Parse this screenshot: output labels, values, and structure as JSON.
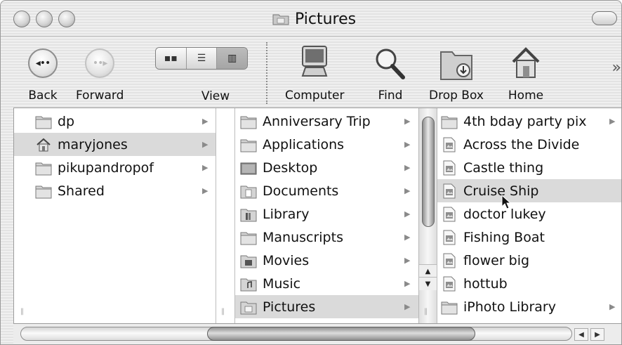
{
  "window": {
    "title": "Pictures"
  },
  "toolbar": {
    "back_label": "Back",
    "forward_label": "Forward",
    "view_label": "View",
    "computer_label": "Computer",
    "find_label": "Find",
    "dropbox_label": "Drop Box",
    "home_label": "Home"
  },
  "columns": [
    {
      "items": [
        {
          "label": "dp",
          "icon": "folder-icon",
          "selected": false,
          "has_children": true
        },
        {
          "label": "maryjones",
          "icon": "home-icon",
          "selected": true,
          "has_children": true
        },
        {
          "label": "pikupandropof",
          "icon": "folder-icon",
          "selected": false,
          "has_children": true
        },
        {
          "label": "Shared",
          "icon": "folder-icon",
          "selected": false,
          "has_children": true
        }
      ]
    },
    {
      "items": [
        {
          "label": "Anniversary Trip",
          "icon": "folder-icon",
          "selected": false,
          "has_children": true
        },
        {
          "label": "Applications",
          "icon": "folder-icon",
          "selected": false,
          "has_children": true
        },
        {
          "label": "Desktop",
          "icon": "desktop-folder-icon",
          "selected": false,
          "has_children": true
        },
        {
          "label": "Documents",
          "icon": "documents-folder-icon",
          "selected": false,
          "has_children": true
        },
        {
          "label": "Library",
          "icon": "library-folder-icon",
          "selected": false,
          "has_children": true
        },
        {
          "label": "Manuscripts",
          "icon": "folder-icon",
          "selected": false,
          "has_children": true
        },
        {
          "label": "Movies",
          "icon": "movies-folder-icon",
          "selected": false,
          "has_children": true
        },
        {
          "label": "Music",
          "icon": "music-folder-icon",
          "selected": false,
          "has_children": true
        },
        {
          "label": "Pictures",
          "icon": "pictures-folder-icon",
          "selected": true,
          "has_children": true
        }
      ]
    },
    {
      "items": [
        {
          "label": "4th bday party pix",
          "icon": "folder-icon",
          "selected": false,
          "has_children": true
        },
        {
          "label": "Across the Divide",
          "icon": "image-file-icon",
          "selected": false,
          "has_children": false
        },
        {
          "label": "Castle thing",
          "icon": "image-file-icon",
          "selected": false,
          "has_children": false
        },
        {
          "label": "Cruise Ship",
          "icon": "image-file-icon",
          "selected": true,
          "has_children": false
        },
        {
          "label": "doctor lukey",
          "icon": "image-file-icon",
          "selected": false,
          "has_children": false
        },
        {
          "label": "Fishing Boat",
          "icon": "image-file-icon",
          "selected": false,
          "has_children": false
        },
        {
          "label": "flower big",
          "icon": "image-file-icon",
          "selected": false,
          "has_children": false
        },
        {
          "label": "hottub",
          "icon": "image-file-icon",
          "selected": false,
          "has_children": false
        },
        {
          "label": "iPhoto Library",
          "icon": "folder-icon",
          "selected": false,
          "has_children": true
        }
      ]
    }
  ]
}
